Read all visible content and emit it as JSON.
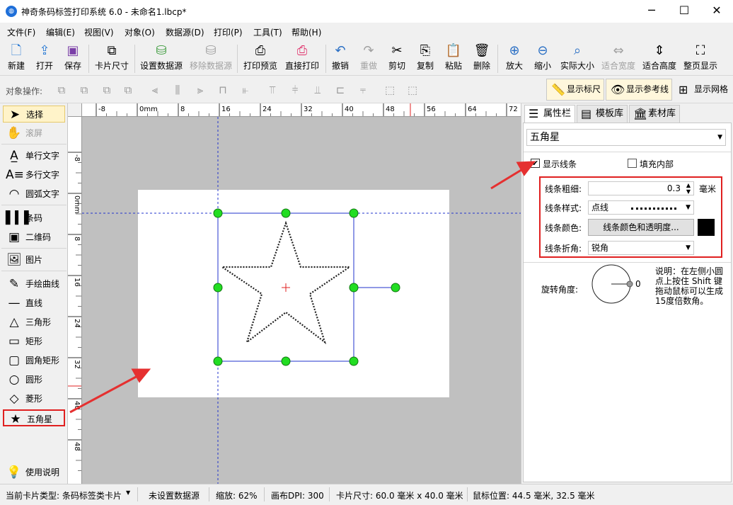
{
  "window": {
    "title": "神奇条码标签打印系统 6.0 - 未命名1.lbcp*",
    "minimize": "─",
    "maximize": "☐",
    "close": "✕"
  },
  "menu": [
    "文件(F)",
    "编辑(E)",
    "视图(V)",
    "对象(O)",
    "数据源(D)",
    "打印(P)",
    "工具(T)",
    "帮助(H)"
  ],
  "toolbar": {
    "new": "新建",
    "open": "打开",
    "save": "保存",
    "card_size": "卡片尺寸",
    "set_datasource": "设置数据源",
    "remove_datasource": "移除数据源",
    "print_preview": "打印预览",
    "direct_print": "直接打印",
    "undo": "撤销",
    "redo": "重做",
    "cut": "剪切",
    "copy": "复制",
    "paste": "粘贴",
    "delete": "删除",
    "zoom_in": "放大",
    "zoom_out": "缩小",
    "actual_size": "实际大小",
    "fit_width": "适合宽度",
    "fit_height": "适合高度",
    "fit_page": "整页显示"
  },
  "objbar": {
    "label": "对象操作:",
    "show_ruler": "显示标尺",
    "show_guides": "显示参考线",
    "show_grid": "显示网格"
  },
  "tools": {
    "select": "选择",
    "scroll": "滚屏",
    "single_text": "单行文字",
    "multi_text": "多行文字",
    "arc_text": "圆弧文字",
    "barcode": "条码",
    "qrcode": "二维码",
    "image": "图片",
    "freehand": "手绘曲线",
    "line": "直线",
    "triangle": "三角形",
    "rectangle": "矩形",
    "rounded_rect": "圆角矩形",
    "circle": "圆形",
    "diamond": "菱形",
    "star": "五角星",
    "help": "使用说明"
  },
  "ruler": {
    "h_ticks": [
      "-8",
      "0mm",
      "8",
      "16",
      "24",
      "32",
      "40",
      "48",
      "56",
      "64",
      "72"
    ],
    "v_ticks": [
      "-8",
      "0mm",
      "8",
      "16",
      "24",
      "32",
      "40",
      "48"
    ]
  },
  "panel": {
    "tabs": [
      "属性栏",
      "模板库",
      "素材库"
    ],
    "object_selector": "五角星",
    "show_line": "显示线条",
    "fill_inside": "填充内部",
    "line_width_label": "线条粗细:",
    "line_width_value": "0.3",
    "line_width_unit": "毫米",
    "line_style_label": "线条样式:",
    "line_style_value": "点线",
    "line_color_label": "线条颜色:",
    "line_color_button": "线条颜色和透明度...",
    "line_color": "#000000",
    "line_join_label": "线条折角:",
    "line_join_value": "锐角",
    "rotation_label": "旋转角度:",
    "rotation_value": "0",
    "note": [
      "说明：在左侧小圆",
      "点上按住 Shift 键",
      "拖动鼠标可以生成",
      "15度倍数角。"
    ]
  },
  "status": {
    "card_type": "当前卡片类型: 条码标签类卡片",
    "datasource": "未设置数据源",
    "zoom": "缩放: 62%",
    "dpi": "画布DPI: 300",
    "card_size": "卡片尺寸: 60.0 毫米 x 40.0 毫米",
    "mouse": "鼠标位置: 44.5 毫米, 32.5 毫米"
  },
  "colors": {
    "handle": "#22dd22",
    "guide": "#2233cc",
    "highlight": "#e02020",
    "arrow": "#e53030"
  }
}
